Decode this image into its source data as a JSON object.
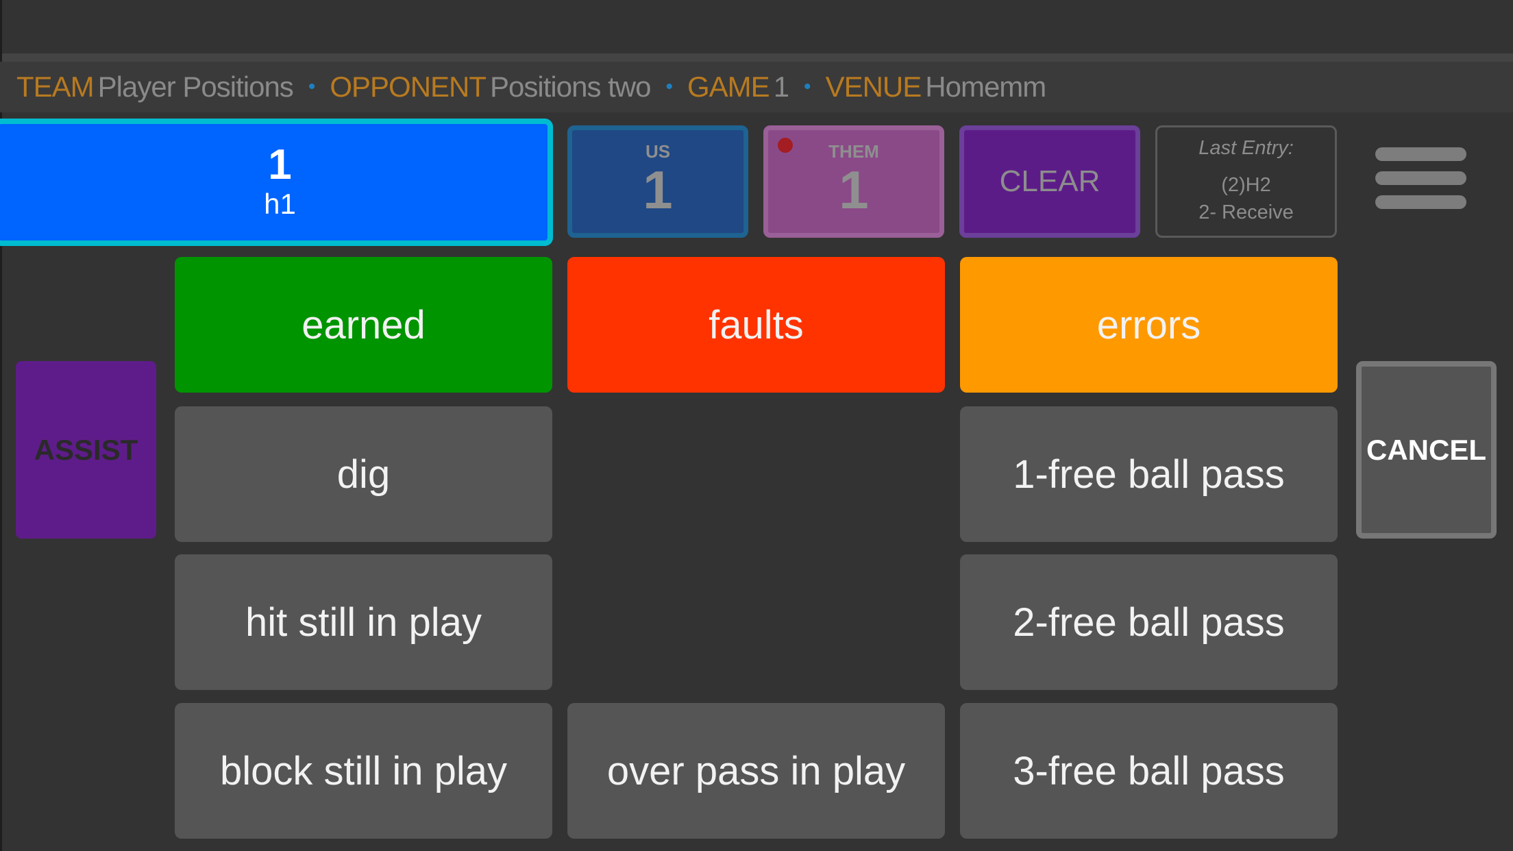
{
  "info_bar": {
    "team_key": "TEAM",
    "team_value": "Player Positions",
    "opponent_key": "OPPONENT",
    "opponent_value": "Positions two",
    "game_key": "GAME",
    "game_value": "1",
    "venue_key": "VENUE",
    "venue_value": "Homemm",
    "separator": "•"
  },
  "player": {
    "number": "1",
    "name": "h1"
  },
  "score": {
    "us_label": "US",
    "us_value": "1",
    "them_label": "THEM",
    "them_value": "1",
    "serving_indicator": "them"
  },
  "controls": {
    "clear_label": "CLEAR",
    "menu_icon": "hamburger-menu-icon",
    "assist_label": "ASSIST",
    "cancel_label": "CANCEL"
  },
  "last_entry": {
    "title": "Last Entry:",
    "line1": "(2)H2",
    "line2": "2- Receive"
  },
  "actions": {
    "earned": "earned",
    "faults": "faults",
    "errors": "errors",
    "dig": "dig",
    "hit_still_in_play": "hit still in play",
    "block_still_in_play": "block still in play",
    "over_pass_in_play": "over pass in play",
    "free_ball_pass_1": "1-free ball pass",
    "free_ball_pass_2": "2-free ball pass",
    "free_ball_pass_3": "3-free ball pass"
  },
  "colors": {
    "background": "#333333",
    "player_blue": "#0064ff",
    "player_border": "#00bcd0",
    "earned_green": "#009400",
    "faults_red": "#ff3300",
    "errors_orange": "#ff9900",
    "neutral_button": "#555555",
    "purple": "#5e1c8a",
    "key_text_orange": "#b87a20"
  }
}
